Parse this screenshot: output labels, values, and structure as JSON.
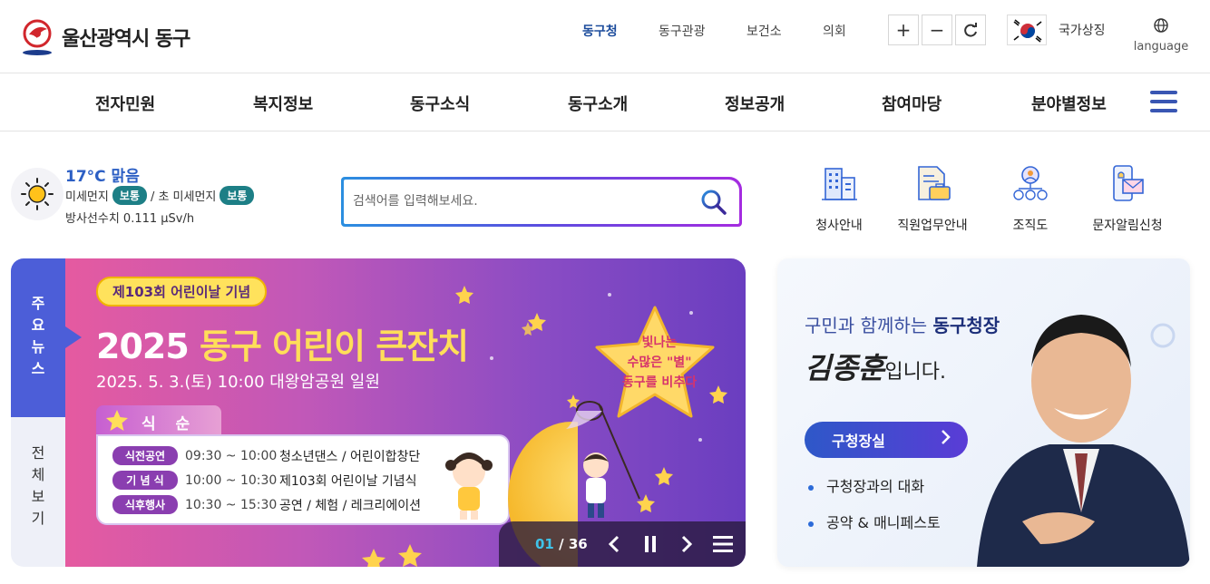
{
  "site": {
    "name": "울산광역시 동구"
  },
  "util_links": [
    {
      "label": "동구청",
      "active": true
    },
    {
      "label": "동구관광"
    },
    {
      "label": "보건소"
    },
    {
      "label": "의회"
    }
  ],
  "zoom": {
    "plus": "+",
    "minus": "−",
    "reset_icon": "refresh-icon"
  },
  "national_symbol": {
    "label": "국가상징"
  },
  "language": {
    "label": "language",
    "icon": "globe-icon"
  },
  "gnb": [
    "전자민원",
    "복지정보",
    "동구소식",
    "동구소개",
    "정보공개",
    "참여마당",
    "분야별정보"
  ],
  "weather": {
    "temperature": "17°C 맑음",
    "fine_dust_label": "미세먼지",
    "fine_dust_status": "보통",
    "ultrafine_label": "/ 초 미세먼지",
    "ultrafine_status": "보통",
    "radiation": "방사선수치 0.111 μSv/h"
  },
  "search": {
    "placeholder": "검색어를 입력해보세요."
  },
  "quick_links": [
    {
      "label": "청사안내",
      "icon": "building-icon"
    },
    {
      "label": "직원업무안내",
      "icon": "briefcase-document-icon"
    },
    {
      "label": "조직도",
      "icon": "org-chart-icon"
    },
    {
      "label": "문자알림신청",
      "icon": "mobile-mail-icon"
    }
  ],
  "news": {
    "tab_main": [
      "주",
      "요",
      "뉴",
      "스"
    ],
    "tab_all": [
      "전",
      "체",
      "보",
      "기"
    ],
    "slide": {
      "tag": "제103회 어린이날 기념",
      "title_prefix": "2025 ",
      "title_highlight": "동구 어린이 큰잔치",
      "date": "2025. 5. 3.(토) 10:00 대왕암공원 일원",
      "order_title": "식 순",
      "order": [
        {
          "tag": "식전공연",
          "time": "09:30 ~ 10:00",
          "desc": "청소년댄스 / 어린이합창단"
        },
        {
          "tag": "기 념 식",
          "time": "10:00 ~ 10:30",
          "desc": "제103회 어린이날 기념식"
        },
        {
          "tag": "식후행사",
          "time": "10:30 ~ 15:30",
          "desc": "공연 / 체험 / 레크리에이션"
        }
      ],
      "bubble": [
        "빛나는",
        "수많은 \"별\"",
        "동구를 비추다"
      ]
    },
    "counter": {
      "current": "01",
      "sep": " / ",
      "total": "36"
    }
  },
  "mayor": {
    "subtitle_prefix": "구민과 함께하는 ",
    "subtitle_emph": "동구청장",
    "name": "김종훈",
    "name_suffix": "입니다.",
    "button": "구청장실",
    "links": [
      "구청장과의 대화",
      "공약 & 매니페스토"
    ]
  },
  "colors": {
    "brand_blue": "#1c4c9c",
    "accent_purple": "#4c5ed8",
    "badge_teal": "#1d7f86"
  }
}
